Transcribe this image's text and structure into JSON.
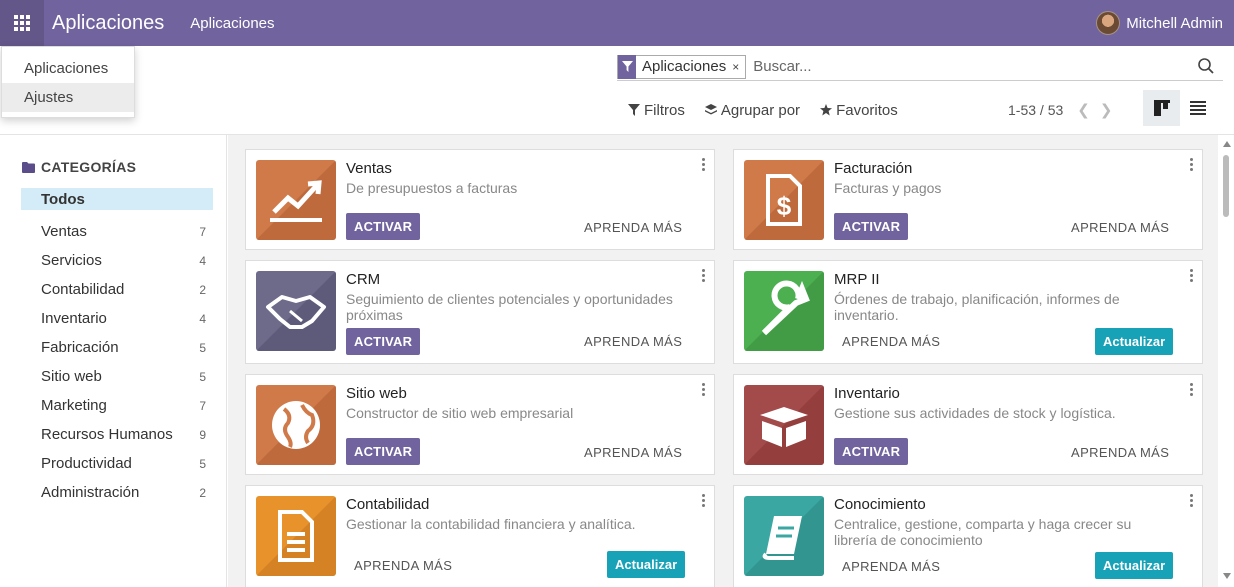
{
  "navbar": {
    "brand": "Aplicaciones",
    "menu": "Aplicaciones",
    "user": "Mitchell Admin",
    "color": "#71639e"
  },
  "dropdown": {
    "items": [
      "Aplicaciones",
      "Ajustes"
    ],
    "active": "Ajustes"
  },
  "search": {
    "facet": "Aplicaciones",
    "facet_close": "×",
    "placeholder": "Buscar..."
  },
  "controls": {
    "filters": "Filtros",
    "group_by": "Agrupar por",
    "favorites": "Favoritos",
    "pager": "1-53 / 53"
  },
  "sidebar": {
    "header": "CATEGORÍAS",
    "items": [
      {
        "label": "Todos",
        "count": ""
      },
      {
        "label": "Ventas",
        "count": "7"
      },
      {
        "label": "Servicios",
        "count": "4"
      },
      {
        "label": "Contabilidad",
        "count": "2"
      },
      {
        "label": "Inventario",
        "count": "4"
      },
      {
        "label": "Fabricación",
        "count": "5"
      },
      {
        "label": "Sitio web",
        "count": "5"
      },
      {
        "label": "Marketing",
        "count": "7"
      },
      {
        "label": "Recursos Humanos",
        "count": "9"
      },
      {
        "label": "Productividad",
        "count": "5"
      },
      {
        "label": "Administración",
        "count": "2"
      }
    ]
  },
  "apps": [
    {
      "name": "Ventas",
      "desc": "De presupuestos a facturas",
      "action": "ACTIVAR",
      "learn": "APRENDA MÁS",
      "icon": "sales-chart-icon"
    },
    {
      "name": "Facturación",
      "desc": "Facturas y pagos",
      "action": "ACTIVAR",
      "learn": "APRENDA MÁS",
      "icon": "invoice-icon"
    },
    {
      "name": "CRM",
      "desc": "Seguimiento de clientes potenciales y oportunidades próximas",
      "action": "ACTIVAR",
      "learn": "APRENDA MÁS",
      "icon": "handshake-icon"
    },
    {
      "name": "MRP II",
      "desc": "Órdenes de trabajo, planificación, informes de inventario.",
      "action": "Actualizar",
      "learn": "APRENDA MÁS",
      "icon": "wrench-icon"
    },
    {
      "name": "Sitio web",
      "desc": "Constructor de sitio web empresarial",
      "action": "ACTIVAR",
      "learn": "APRENDA MÁS",
      "icon": "globe-icon"
    },
    {
      "name": "Inventario",
      "desc": "Gestione sus actividades de stock y logística.",
      "action": "ACTIVAR",
      "learn": "APRENDA MÁS",
      "icon": "box-icon"
    },
    {
      "name": "Contabilidad",
      "desc": "Gestionar la contabilidad financiera y analítica.",
      "action": "Actualizar",
      "learn": "APRENDA MÁS",
      "icon": "document-icon"
    },
    {
      "name": "Conocimiento",
      "desc": "Centralice, gestione, comparta y haga crecer su librería de conocimiento",
      "action": "Actualizar",
      "learn": "APRENDA MÁS",
      "icon": "book-icon"
    }
  ],
  "colors": {
    "primary": "#71639e",
    "update": "#17a2b8",
    "sales": "#d07a4a",
    "crm": "#6d6a8a",
    "mrp": "#4caf50",
    "inventory": "#a34a4a",
    "accounting": "#e8922c",
    "knowledge": "#3aa7a2"
  }
}
